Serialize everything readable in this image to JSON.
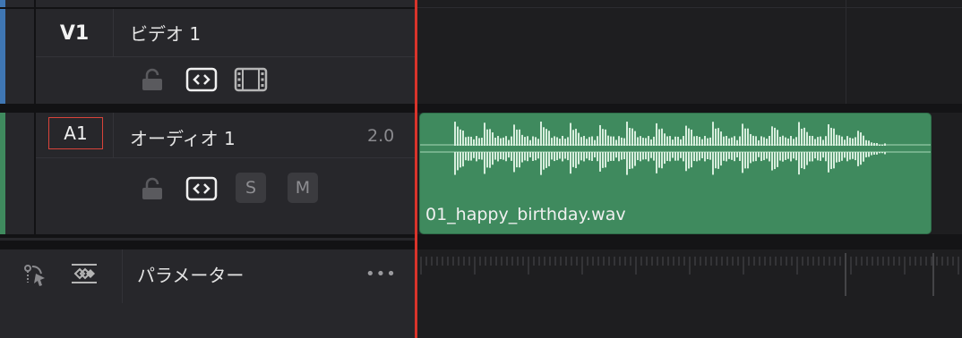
{
  "video_track": {
    "id": "V1",
    "name": "ビデオ 1"
  },
  "audio_track": {
    "id": "A1",
    "name": "オーディオ 1",
    "channels": "2.0"
  },
  "audio_clip": {
    "name": "01_happy_birthday.wav"
  },
  "controls": {
    "solo_label": "S",
    "mute_label": "M",
    "more_label": "•••"
  },
  "parameters_panel": {
    "title": "パラメーター"
  },
  "colors": {
    "video_track": "#3f76b3",
    "audio_track": "#3f8a5e",
    "clip_fill": "#3f8a5e",
    "waveform": "#d6eddc",
    "playhead": "#d9342b",
    "audio_id_border": "#d9433a"
  }
}
